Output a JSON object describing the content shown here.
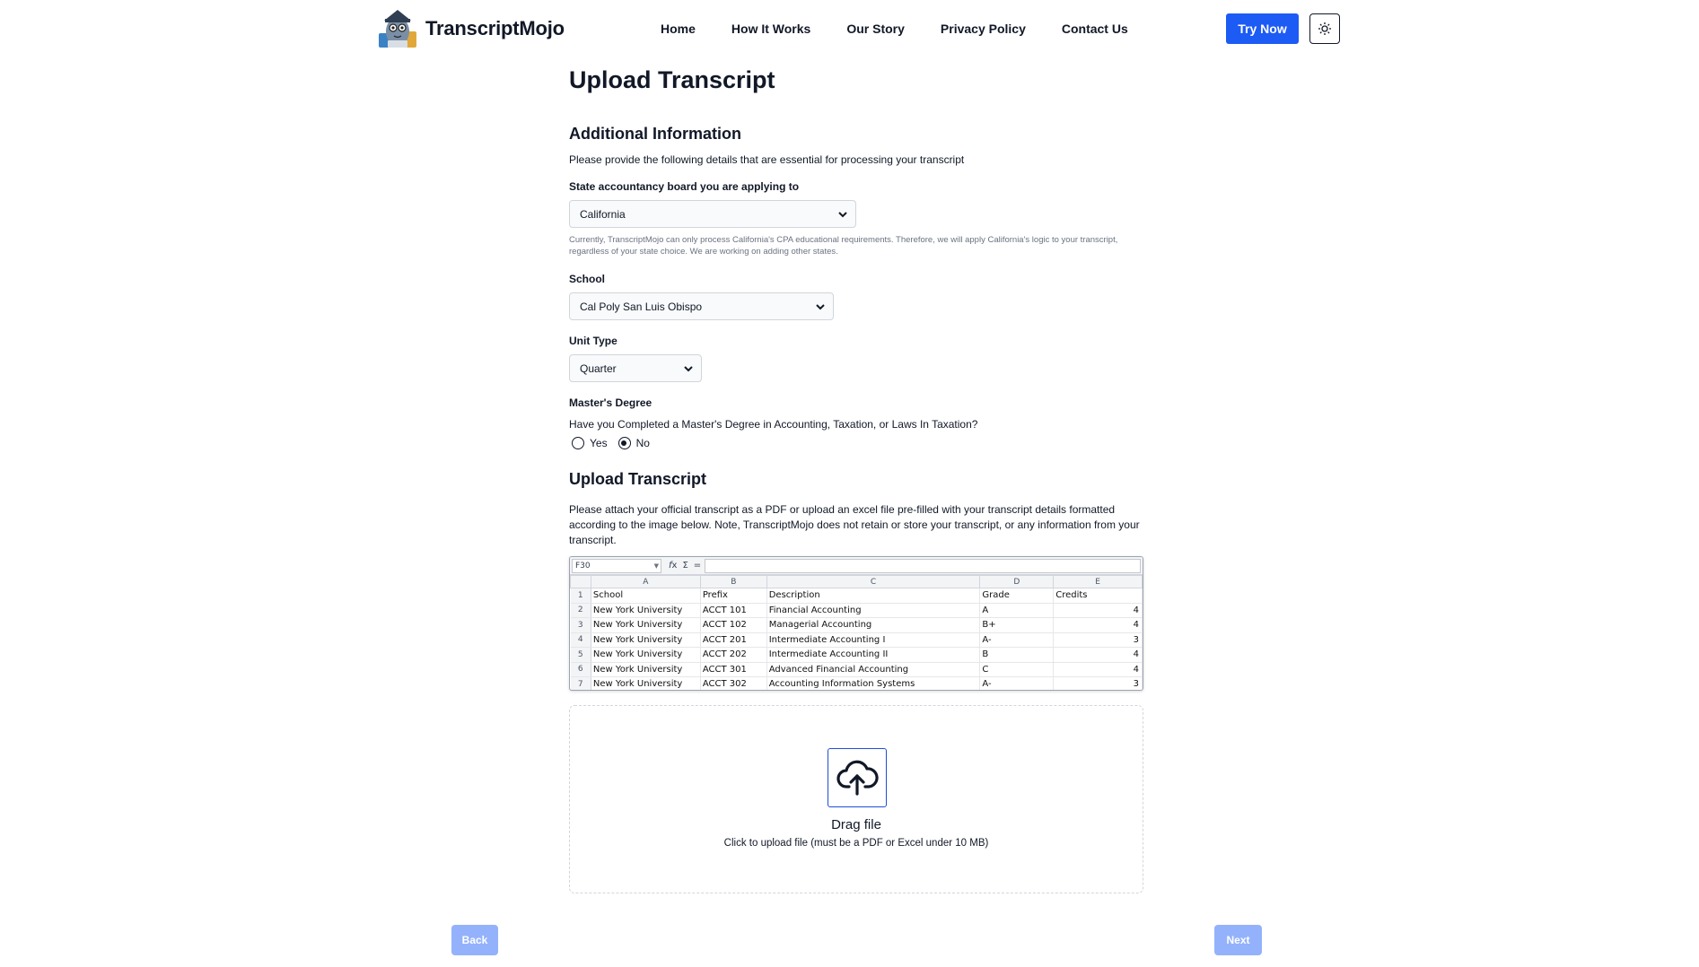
{
  "brand": {
    "name": "TranscriptMojo"
  },
  "nav": {
    "items": [
      "Home",
      "How It Works",
      "Our Story",
      "Privacy Policy",
      "Contact Us"
    ]
  },
  "header": {
    "try_now": "Try Now",
    "theme_icon": "sun-icon"
  },
  "page": {
    "title": "Upload Transcript"
  },
  "additional": {
    "title": "Additional Information",
    "subtitle": "Please provide the following details that are essential for processing your transcript",
    "state_label": "State accountancy board you are applying to",
    "state_value": "California",
    "state_note": "Currently, TranscriptMojo can only process California's CPA educational requirements. Therefore, we will apply California's logic to your transcript, regardless of your state choice. We are working on adding other states.",
    "school_label": "School",
    "school_value": "Cal Poly San Luis Obispo",
    "unit_label": "Unit Type",
    "unit_value": "Quarter",
    "masters_label": "Master's Degree",
    "masters_question": "Have you Completed a Master's Degree in Accounting, Taxation, or Laws In Taxation?",
    "masters_options": [
      "Yes",
      "No"
    ],
    "masters_selected": "No"
  },
  "upload": {
    "title": "Upload Transcript",
    "description": "Please attach your official transcript as a PDF or upload an excel file pre-filled with your transcript details formatted according to the image below. Note, TranscriptMojo does not retain or store your transcript, or any information from your transcript.",
    "drag_title": "Drag file",
    "drag_sub": "Click to upload file (must be a PDF or Excel under 10 MB)"
  },
  "sheet": {
    "cell_ref": "F30",
    "col_letters": [
      "A",
      "B",
      "C",
      "D",
      "E"
    ],
    "headers": [
      "School",
      "Prefix",
      "Description",
      "Grade",
      "Credits"
    ],
    "rows": [
      [
        "New York University",
        "ACCT 101",
        "Financial Accounting",
        "A",
        "4"
      ],
      [
        "New York University",
        "ACCT 102",
        "Managerial Accounting",
        "B+",
        "4"
      ],
      [
        "New York University",
        "ACCT 201",
        "Intermediate Accounting I",
        "A-",
        "3"
      ],
      [
        "New York University",
        "ACCT 202",
        "Intermediate Accounting II",
        "B",
        "4"
      ],
      [
        "New York University",
        "ACCT 301",
        "Advanced Financial Accounting",
        "C",
        "4"
      ],
      [
        "New York University",
        "ACCT 302",
        "Accounting Information Systems",
        "A-",
        "3"
      ]
    ]
  },
  "footer": {
    "back": "Back",
    "next": "Next"
  },
  "colors": {
    "primary": "#1d5bf5",
    "disabled": "#93b2fb"
  }
}
